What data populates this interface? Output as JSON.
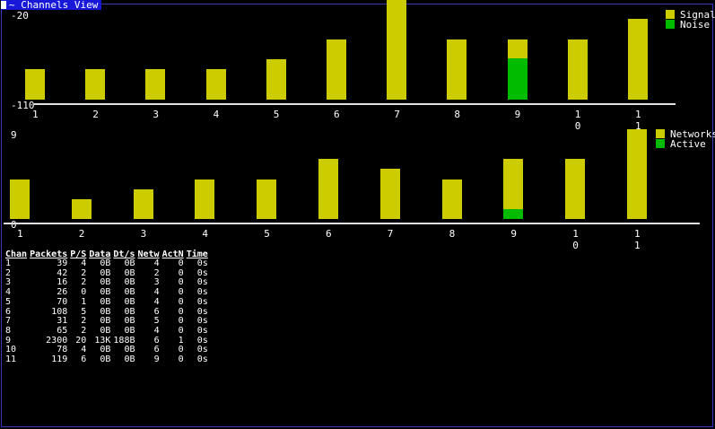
{
  "window": {
    "title": "~ Channels View"
  },
  "colors": {
    "signal": "#cccc00",
    "noise": "#00bb00",
    "axis": "#e0e0e0",
    "border": "#3a3ab8",
    "title_bg": "#1818d8"
  },
  "chart_data": [
    {
      "type": "bar",
      "categories": [
        "1",
        "2",
        "3",
        "4",
        "5",
        "6",
        "7",
        "8",
        "9",
        "10",
        "11"
      ],
      "tick_labels": [
        [
          "1"
        ],
        [
          "2"
        ],
        [
          "3"
        ],
        [
          "4"
        ],
        [
          "5"
        ],
        [
          "6"
        ],
        [
          "7"
        ],
        [
          "8"
        ],
        [
          "9"
        ],
        [
          "1",
          "0"
        ],
        [
          "1",
          "1"
        ]
      ],
      "ylim": [
        -110,
        -20
      ],
      "ytick_labels": {
        "top": "-20",
        "bottom": "-110"
      },
      "legend": {
        "position": "top-right"
      },
      "series": [
        {
          "name": "Signal",
          "values": [
            -80,
            -80,
            -80,
            -80,
            -70,
            -50,
            -10,
            -50,
            -50,
            -50,
            -30
          ]
        },
        {
          "name": "Noise",
          "values": [
            null,
            null,
            null,
            null,
            null,
            null,
            null,
            null,
            -69,
            null,
            null
          ]
        }
      ]
    },
    {
      "type": "bar",
      "categories": [
        "1",
        "2",
        "3",
        "4",
        "5",
        "6",
        "7",
        "8",
        "9",
        "10",
        "11"
      ],
      "tick_labels": [
        [
          "1"
        ],
        [
          "2"
        ],
        [
          "3"
        ],
        [
          "4"
        ],
        [
          "5"
        ],
        [
          "6"
        ],
        [
          "7"
        ],
        [
          "8"
        ],
        [
          "9"
        ],
        [
          "1",
          "0"
        ],
        [
          "1",
          "1"
        ]
      ],
      "ylim": [
        0,
        9
      ],
      "ytick_labels": {
        "top": "9",
        "bottom": "0"
      },
      "legend": {
        "position": "top-right"
      },
      "series": [
        {
          "name": "Networks",
          "values": [
            4,
            2,
            3,
            4,
            4,
            6,
            5,
            4,
            6,
            6,
            9
          ]
        },
        {
          "name": "Active",
          "values": [
            0,
            0,
            0,
            0,
            0,
            0,
            0,
            0,
            1,
            0,
            0
          ]
        }
      ]
    }
  ],
  "table": {
    "headers": [
      "Chan",
      "Packets",
      "P/S",
      "Data",
      "Dt/s",
      "Netw",
      "ActN",
      "Time"
    ],
    "rows": [
      [
        "1",
        "39",
        "4",
        "0B",
        "0B",
        "4",
        "0",
        "0s"
      ],
      [
        "2",
        "42",
        "2",
        "0B",
        "0B",
        "2",
        "0",
        "0s"
      ],
      [
        "3",
        "16",
        "2",
        "0B",
        "0B",
        "3",
        "0",
        "0s"
      ],
      [
        "4",
        "26",
        "0",
        "0B",
        "0B",
        "4",
        "0",
        "0s"
      ],
      [
        "5",
        "70",
        "1",
        "0B",
        "0B",
        "4",
        "0",
        "0s"
      ],
      [
        "6",
        "108",
        "5",
        "0B",
        "0B",
        "6",
        "0",
        "0s"
      ],
      [
        "7",
        "31",
        "2",
        "0B",
        "0B",
        "5",
        "0",
        "0s"
      ],
      [
        "8",
        "65",
        "2",
        "0B",
        "0B",
        "4",
        "0",
        "0s"
      ],
      [
        "9",
        "2300",
        "20",
        "13K",
        "188B",
        "6",
        "1",
        "0s"
      ],
      [
        "10",
        "78",
        "4",
        "0B",
        "0B",
        "6",
        "0",
        "0s"
      ],
      [
        "11",
        "119",
        "6",
        "0B",
        "0B",
        "9",
        "0",
        "0s"
      ]
    ]
  }
}
